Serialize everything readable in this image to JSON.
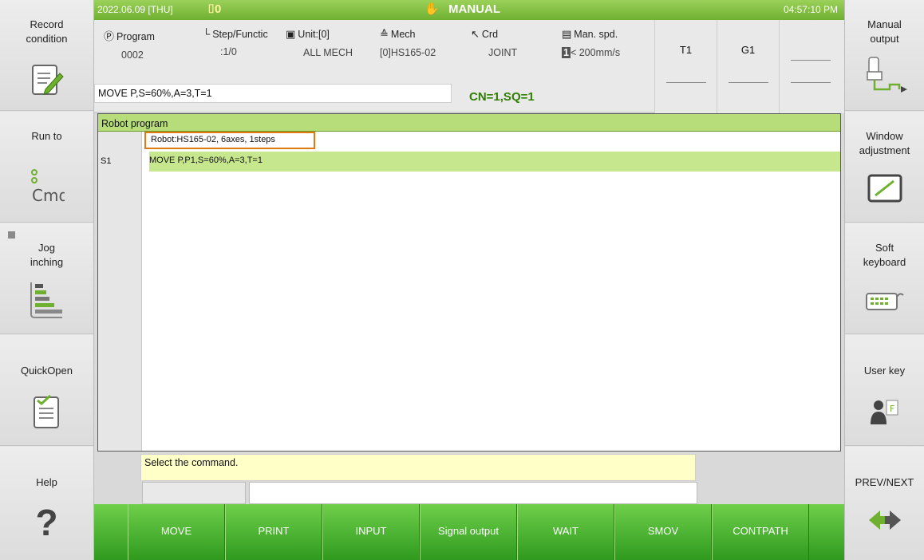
{
  "header": {
    "datetime": "2022.06.09 [THU]",
    "tool_no": "0",
    "mode": "MANUAL",
    "time": "04:57:10 PM"
  },
  "status": {
    "program_label": "Program",
    "program_value": "0002",
    "step_label": "Step/Functic",
    "step_value": ":1/0",
    "unit_label": "Unit:[0]",
    "unit_value": "ALL MECH",
    "mech_label": "Mech",
    "mech_value": "[0]HS165-02",
    "crd_label": "Crd",
    "crd_value": "JOINT",
    "speed_label": "Man. spd.",
    "speed_level": "1",
    "speed_value": "< 200mm/s",
    "command": "MOVE P,S=60%,A=3,T=1",
    "cn_sq": "CN=1,SQ=1"
  },
  "tg": {
    "t1": "T1",
    "g1": "G1"
  },
  "left_buttons": [
    {
      "label": "Record\ncondition"
    },
    {
      "label": "Run to"
    },
    {
      "label": "Jog\ninching"
    },
    {
      "label": "QuickOpen"
    },
    {
      "label": "Help"
    }
  ],
  "right_buttons": [
    {
      "label": "Manual\noutput"
    },
    {
      "label": "Window\nadjustment"
    },
    {
      "label": "Soft\nkeyboard"
    },
    {
      "label": "User key"
    },
    {
      "label": "PREV/NEXT"
    }
  ],
  "program": {
    "title": "Robot program",
    "robot_line": "Robot:HS165-02, 6axes, 1steps",
    "step_label": "S1",
    "step_text": "MOVE P,P1,S=60%,A=3,T=1"
  },
  "message": "Select the command.",
  "function_keys": [
    "MOVE",
    "PRINT",
    "INPUT",
    "Signal output",
    "WAIT",
    "SMOV",
    "CONTPATH"
  ],
  "colors": {
    "accent_green": "#6fb030",
    "highlight_orange": "#e07a10",
    "message_yellow": "#ffffc8"
  }
}
